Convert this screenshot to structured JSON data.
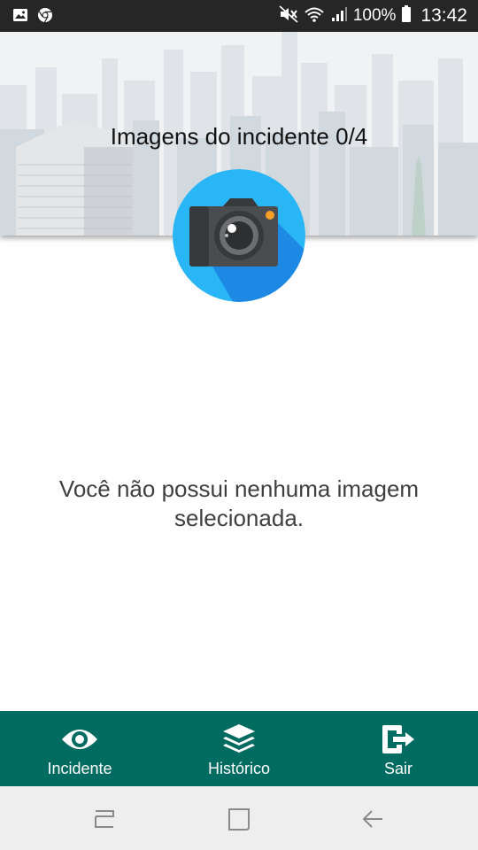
{
  "status_bar": {
    "battery": "100%",
    "time": "13:42",
    "icons": [
      "gallery-icon",
      "chrome-icon",
      "mute-icon",
      "wifi-icon",
      "signal-icon",
      "battery-icon"
    ]
  },
  "header": {
    "title": "Imagens do incidente 0/4"
  },
  "camera": {
    "icon": "camera-icon",
    "circle_color": "#29b6f6",
    "shadow_color": "#1e88e5"
  },
  "main": {
    "empty_message": "Você não possui nenhuma imagem selecionada."
  },
  "bottom_nav": {
    "background": "#006b61",
    "items": [
      {
        "label": "Incidente",
        "icon": "eye-icon"
      },
      {
        "label": "Histórico",
        "icon": "layers-icon"
      },
      {
        "label": "Sair",
        "icon": "logout-icon"
      }
    ]
  },
  "system_nav": {
    "buttons": [
      "recent-apps-icon",
      "home-icon",
      "back-icon"
    ]
  }
}
